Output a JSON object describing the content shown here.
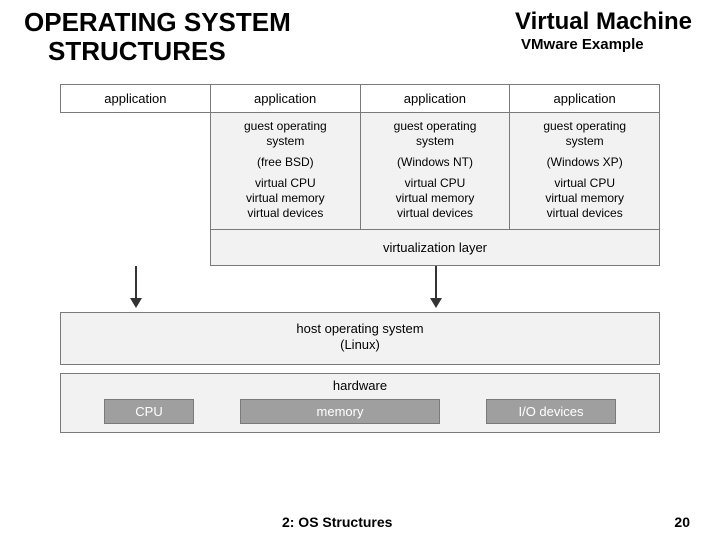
{
  "header": {
    "left_line1": "OPERATING SYSTEM",
    "left_line2": "STRUCTURES",
    "right_line1": "Virtual Machine",
    "right_line2": "VMware Example"
  },
  "apps": [
    "application",
    "application",
    "application",
    "application"
  ],
  "guests": [
    {
      "gos": "guest operating\nsystem",
      "osname": "(free BSD)",
      "res": "virtual CPU\nvirtual memory\nvirtual devices"
    },
    {
      "gos": "guest operating\nsystem",
      "osname": "(Windows NT)",
      "res": "virtual CPU\nvirtual memory\nvirtual devices"
    },
    {
      "gos": "guest operating\nsystem",
      "osname": "(Windows XP)",
      "res": "virtual CPU\nvirtual memory\nvirtual devices"
    }
  ],
  "virt_layer": "virtualization layer",
  "host_os_line1": "host operating system",
  "host_os_line2": "(Linux)",
  "hardware_label": "hardware",
  "hardware_items": [
    "CPU",
    "memory",
    "I/O devices"
  ],
  "footer": {
    "title": "2: OS Structures",
    "page": "20"
  }
}
